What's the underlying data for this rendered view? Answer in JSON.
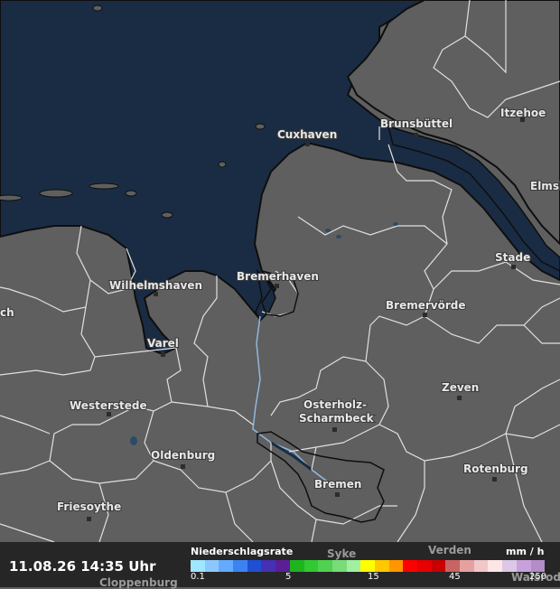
{
  "map": {
    "cities": [
      {
        "name": "Cuxhaven"
      },
      {
        "name": "Brunsbüttel"
      },
      {
        "name": "Itzehoe"
      },
      {
        "name": "Elmsh"
      },
      {
        "name": "Stade"
      },
      {
        "name": "Bremerhaven"
      },
      {
        "name": "Wilhelmshaven"
      },
      {
        "name": "Bremervörde"
      },
      {
        "name": "ch"
      },
      {
        "name": "Varel"
      },
      {
        "name": "Westerstede"
      },
      {
        "name": "Osterholz-"
      },
      {
        "name": "Scharmbeck"
      },
      {
        "name": "Zeven"
      },
      {
        "name": "Oldenburg"
      },
      {
        "name": "Rotenburg"
      },
      {
        "name": "Bremen"
      },
      {
        "name": "Friesoythe"
      }
    ],
    "partial_labels": {
      "syke": "Syke",
      "verden": "Verden",
      "walsrode": "Walsrode",
      "cloppenburg": "Cloppenburg"
    },
    "colors": {
      "land": "#5f5f5f",
      "sea": "#1a2c44",
      "border": "#d8d8d8",
      "coast": "#101010",
      "river": "#8fb8e0"
    }
  },
  "legend": {
    "timestamp": "11.08.26 14:35 Uhr",
    "title": "Niederschlagsrate",
    "unit": "mm / h",
    "ticks": [
      "0.1",
      "5",
      "15",
      "45",
      "250"
    ],
    "colors": [
      "#a0e6ff",
      "#8cc8ff",
      "#64aaff",
      "#3c82f0",
      "#1e50d2",
      "#4630b4",
      "#5a1e96",
      "#1eb41e",
      "#32c832",
      "#50d250",
      "#78dc78",
      "#a0f0a0",
      "#ffff00",
      "#ffc800",
      "#ff9600",
      "#ff0000",
      "#e60000",
      "#c80000",
      "#c86464",
      "#e6a0a0",
      "#f0c8c8",
      "#ffe6e6",
      "#dcc8e6",
      "#c8a0dc",
      "#b48cc8"
    ]
  }
}
